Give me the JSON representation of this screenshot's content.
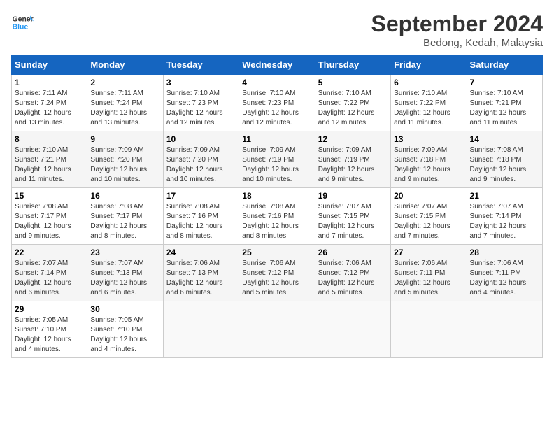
{
  "header": {
    "logo_line1": "General",
    "logo_line2": "Blue",
    "month": "September 2024",
    "location": "Bedong, Kedah, Malaysia"
  },
  "weekdays": [
    "Sunday",
    "Monday",
    "Tuesday",
    "Wednesday",
    "Thursday",
    "Friday",
    "Saturday"
  ],
  "weeks": [
    [
      {
        "day": "1",
        "sunrise": "7:11 AM",
        "sunset": "7:24 PM",
        "daylight": "12 hours and 13 minutes."
      },
      {
        "day": "2",
        "sunrise": "7:11 AM",
        "sunset": "7:24 PM",
        "daylight": "12 hours and 13 minutes."
      },
      {
        "day": "3",
        "sunrise": "7:10 AM",
        "sunset": "7:23 PM",
        "daylight": "12 hours and 12 minutes."
      },
      {
        "day": "4",
        "sunrise": "7:10 AM",
        "sunset": "7:23 PM",
        "daylight": "12 hours and 12 minutes."
      },
      {
        "day": "5",
        "sunrise": "7:10 AM",
        "sunset": "7:22 PM",
        "daylight": "12 hours and 12 minutes."
      },
      {
        "day": "6",
        "sunrise": "7:10 AM",
        "sunset": "7:22 PM",
        "daylight": "12 hours and 11 minutes."
      },
      {
        "day": "7",
        "sunrise": "7:10 AM",
        "sunset": "7:21 PM",
        "daylight": "12 hours and 11 minutes."
      }
    ],
    [
      {
        "day": "8",
        "sunrise": "7:10 AM",
        "sunset": "7:21 PM",
        "daylight": "12 hours and 11 minutes."
      },
      {
        "day": "9",
        "sunrise": "7:09 AM",
        "sunset": "7:20 PM",
        "daylight": "12 hours and 10 minutes."
      },
      {
        "day": "10",
        "sunrise": "7:09 AM",
        "sunset": "7:20 PM",
        "daylight": "12 hours and 10 minutes."
      },
      {
        "day": "11",
        "sunrise": "7:09 AM",
        "sunset": "7:19 PM",
        "daylight": "12 hours and 10 minutes."
      },
      {
        "day": "12",
        "sunrise": "7:09 AM",
        "sunset": "7:19 PM",
        "daylight": "12 hours and 9 minutes."
      },
      {
        "day": "13",
        "sunrise": "7:09 AM",
        "sunset": "7:18 PM",
        "daylight": "12 hours and 9 minutes."
      },
      {
        "day": "14",
        "sunrise": "7:08 AM",
        "sunset": "7:18 PM",
        "daylight": "12 hours and 9 minutes."
      }
    ],
    [
      {
        "day": "15",
        "sunrise": "7:08 AM",
        "sunset": "7:17 PM",
        "daylight": "12 hours and 9 minutes."
      },
      {
        "day": "16",
        "sunrise": "7:08 AM",
        "sunset": "7:17 PM",
        "daylight": "12 hours and 8 minutes."
      },
      {
        "day": "17",
        "sunrise": "7:08 AM",
        "sunset": "7:16 PM",
        "daylight": "12 hours and 8 minutes."
      },
      {
        "day": "18",
        "sunrise": "7:08 AM",
        "sunset": "7:16 PM",
        "daylight": "12 hours and 8 minutes."
      },
      {
        "day": "19",
        "sunrise": "7:07 AM",
        "sunset": "7:15 PM",
        "daylight": "12 hours and 7 minutes."
      },
      {
        "day": "20",
        "sunrise": "7:07 AM",
        "sunset": "7:15 PM",
        "daylight": "12 hours and 7 minutes."
      },
      {
        "day": "21",
        "sunrise": "7:07 AM",
        "sunset": "7:14 PM",
        "daylight": "12 hours and 7 minutes."
      }
    ],
    [
      {
        "day": "22",
        "sunrise": "7:07 AM",
        "sunset": "7:14 PM",
        "daylight": "12 hours and 6 minutes."
      },
      {
        "day": "23",
        "sunrise": "7:07 AM",
        "sunset": "7:13 PM",
        "daylight": "12 hours and 6 minutes."
      },
      {
        "day": "24",
        "sunrise": "7:06 AM",
        "sunset": "7:13 PM",
        "daylight": "12 hours and 6 minutes."
      },
      {
        "day": "25",
        "sunrise": "7:06 AM",
        "sunset": "7:12 PM",
        "daylight": "12 hours and 5 minutes."
      },
      {
        "day": "26",
        "sunrise": "7:06 AM",
        "sunset": "7:12 PM",
        "daylight": "12 hours and 5 minutes."
      },
      {
        "day": "27",
        "sunrise": "7:06 AM",
        "sunset": "7:11 PM",
        "daylight": "12 hours and 5 minutes."
      },
      {
        "day": "28",
        "sunrise": "7:06 AM",
        "sunset": "7:11 PM",
        "daylight": "12 hours and 4 minutes."
      }
    ],
    [
      {
        "day": "29",
        "sunrise": "7:05 AM",
        "sunset": "7:10 PM",
        "daylight": "12 hours and 4 minutes."
      },
      {
        "day": "30",
        "sunrise": "7:05 AM",
        "sunset": "7:10 PM",
        "daylight": "12 hours and 4 minutes."
      },
      null,
      null,
      null,
      null,
      null
    ]
  ]
}
